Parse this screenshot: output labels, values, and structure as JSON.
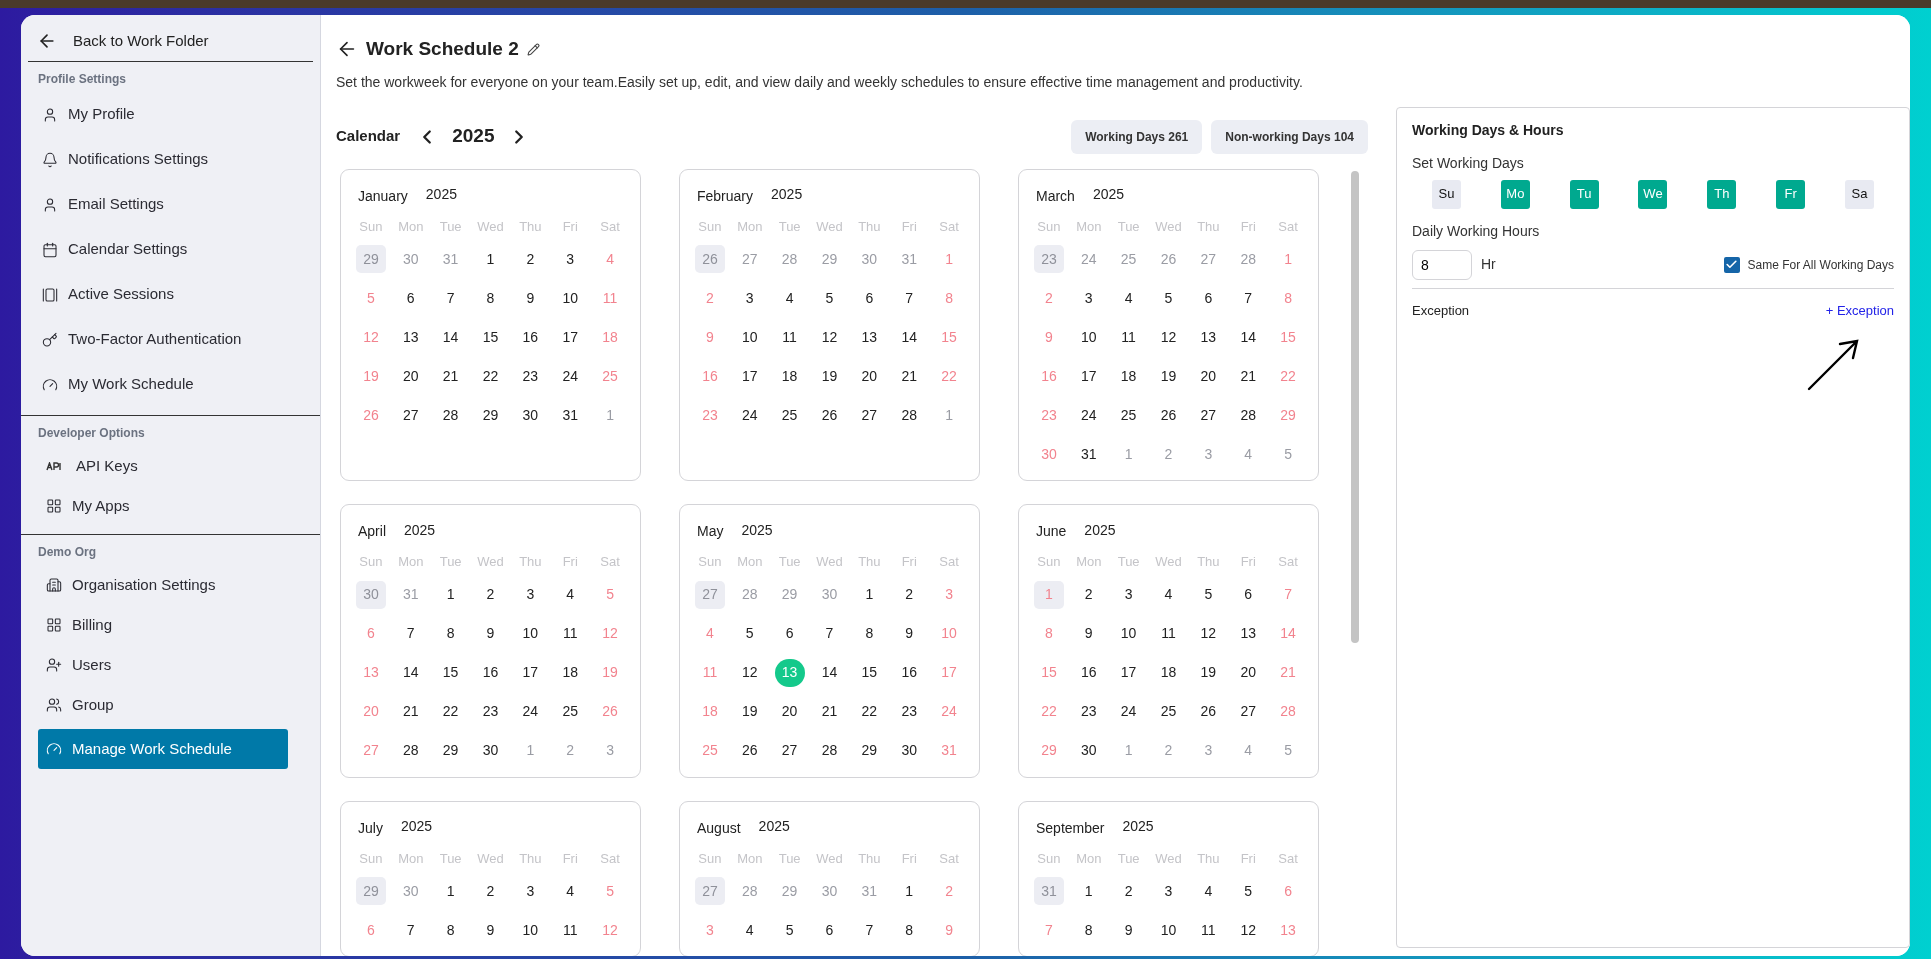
{
  "sidebar": {
    "back": {
      "label": "Back to Work Folder"
    },
    "sections": [
      {
        "title": "Profile Settings",
        "items": [
          {
            "label": "My Profile",
            "selected": false
          },
          {
            "label": "Notifications Settings",
            "selected": false
          },
          {
            "label": "Email Settings",
            "selected": false
          },
          {
            "label": "Calendar Settings",
            "selected": false
          },
          {
            "label": "Active Sessions",
            "selected": false
          },
          {
            "label": "Two-Factor Authentication",
            "selected": false
          },
          {
            "label": "My Work Schedule",
            "selected": false
          }
        ]
      },
      {
        "title": "Developer Options",
        "items": [
          {
            "label": "API Keys",
            "selected": false
          },
          {
            "label": "My Apps",
            "selected": false
          }
        ]
      },
      {
        "title": "Demo Org",
        "items": [
          {
            "label": "Organisation Settings",
            "selected": false
          },
          {
            "label": "Billing",
            "selected": false
          },
          {
            "label": "Users",
            "selected": false
          },
          {
            "label": "Group",
            "selected": false
          },
          {
            "label": "Manage Work Schedule",
            "selected": true
          }
        ]
      }
    ]
  },
  "header": {
    "title": "Work Schedule 2",
    "description": "Set the workweek for everyone on your team.Easily set up, edit, and view daily and weekly schedules to ensure effective time management and productivity."
  },
  "calendar": {
    "label": "Calendar",
    "year": "2025",
    "stats": [
      "Working Days 261",
      "Non-working Days 104"
    ],
    "months": [
      {
        "name": "January",
        "year": "2025",
        "weekdays": [
          "Sun",
          "Mon",
          "Tue",
          "Wed",
          "Thu",
          "Fri",
          "Sat"
        ],
        "weeks": [
          [
            {
              "day": "29",
              "kind": "out_mark"
            },
            {
              "day": "30",
              "kind": "out"
            },
            {
              "day": "31",
              "kind": "out"
            },
            {
              "day": "1",
              "kind": "work"
            },
            {
              "day": "2",
              "kind": "work"
            },
            {
              "day": "3",
              "kind": "work"
            },
            {
              "day": "4",
              "kind": "off"
            }
          ],
          [
            {
              "day": "5",
              "kind": "off"
            },
            {
              "day": "6",
              "kind": "work"
            },
            {
              "day": "7",
              "kind": "work"
            },
            {
              "day": "8",
              "kind": "work"
            },
            {
              "day": "9",
              "kind": "work"
            },
            {
              "day": "10",
              "kind": "work"
            },
            {
              "day": "11",
              "kind": "off"
            }
          ],
          [
            {
              "day": "12",
              "kind": "off"
            },
            {
              "day": "13",
              "kind": "work"
            },
            {
              "day": "14",
              "kind": "work"
            },
            {
              "day": "15",
              "kind": "work"
            },
            {
              "day": "16",
              "kind": "work"
            },
            {
              "day": "17",
              "kind": "work"
            },
            {
              "day": "18",
              "kind": "off"
            }
          ],
          [
            {
              "day": "19",
              "kind": "off"
            },
            {
              "day": "20",
              "kind": "work"
            },
            {
              "day": "21",
              "kind": "work"
            },
            {
              "day": "22",
              "kind": "work"
            },
            {
              "day": "23",
              "kind": "work"
            },
            {
              "day": "24",
              "kind": "work"
            },
            {
              "day": "25",
              "kind": "off"
            }
          ],
          [
            {
              "day": "26",
              "kind": "off"
            },
            {
              "day": "27",
              "kind": "work"
            },
            {
              "day": "28",
              "kind": "work"
            },
            {
              "day": "29",
              "kind": "work"
            },
            {
              "day": "30",
              "kind": "work"
            },
            {
              "day": "31",
              "kind": "work"
            },
            {
              "day": "1",
              "kind": "out"
            }
          ]
        ]
      },
      {
        "name": "February",
        "year": "2025",
        "weekdays": [
          "Sun",
          "Mon",
          "Tue",
          "Wed",
          "Thu",
          "Fri",
          "Sat"
        ],
        "weeks": [
          [
            {
              "day": "26",
              "kind": "out_mark"
            },
            {
              "day": "27",
              "kind": "out"
            },
            {
              "day": "28",
              "kind": "out"
            },
            {
              "day": "29",
              "kind": "out"
            },
            {
              "day": "30",
              "kind": "out"
            },
            {
              "day": "31",
              "kind": "out"
            },
            {
              "day": "1",
              "kind": "off"
            }
          ],
          [
            {
              "day": "2",
              "kind": "off"
            },
            {
              "day": "3",
              "kind": "work"
            },
            {
              "day": "4",
              "kind": "work"
            },
            {
              "day": "5",
              "kind": "work"
            },
            {
              "day": "6",
              "kind": "work"
            },
            {
              "day": "7",
              "kind": "work"
            },
            {
              "day": "8",
              "kind": "off"
            }
          ],
          [
            {
              "day": "9",
              "kind": "off"
            },
            {
              "day": "10",
              "kind": "work"
            },
            {
              "day": "11",
              "kind": "work"
            },
            {
              "day": "12",
              "kind": "work"
            },
            {
              "day": "13",
              "kind": "work"
            },
            {
              "day": "14",
              "kind": "work"
            },
            {
              "day": "15",
              "kind": "off"
            }
          ],
          [
            {
              "day": "16",
              "kind": "off"
            },
            {
              "day": "17",
              "kind": "work"
            },
            {
              "day": "18",
              "kind": "work"
            },
            {
              "day": "19",
              "kind": "work"
            },
            {
              "day": "20",
              "kind": "work"
            },
            {
              "day": "21",
              "kind": "work"
            },
            {
              "day": "22",
              "kind": "off"
            }
          ],
          [
            {
              "day": "23",
              "kind": "off"
            },
            {
              "day": "24",
              "kind": "work"
            },
            {
              "day": "25",
              "kind": "work"
            },
            {
              "day": "26",
              "kind": "work"
            },
            {
              "day": "27",
              "kind": "work"
            },
            {
              "day": "28",
              "kind": "work"
            },
            {
              "day": "1",
              "kind": "out"
            }
          ]
        ]
      },
      {
        "name": "March",
        "year": "2025",
        "weekdays": [
          "Sun",
          "Mon",
          "Tue",
          "Wed",
          "Thu",
          "Fri",
          "Sat"
        ],
        "weeks": [
          [
            {
              "day": "23",
              "kind": "out_mark"
            },
            {
              "day": "24",
              "kind": "out"
            },
            {
              "day": "25",
              "kind": "out"
            },
            {
              "day": "26",
              "kind": "out"
            },
            {
              "day": "27",
              "kind": "out"
            },
            {
              "day": "28",
              "kind": "out"
            },
            {
              "day": "1",
              "kind": "off"
            }
          ],
          [
            {
              "day": "2",
              "kind": "off"
            },
            {
              "day": "3",
              "kind": "work"
            },
            {
              "day": "4",
              "kind": "work"
            },
            {
              "day": "5",
              "kind": "work"
            },
            {
              "day": "6",
              "kind": "work"
            },
            {
              "day": "7",
              "kind": "work"
            },
            {
              "day": "8",
              "kind": "off"
            }
          ],
          [
            {
              "day": "9",
              "kind": "off"
            },
            {
              "day": "10",
              "kind": "work"
            },
            {
              "day": "11",
              "kind": "work"
            },
            {
              "day": "12",
              "kind": "work"
            },
            {
              "day": "13",
              "kind": "work"
            },
            {
              "day": "14",
              "kind": "work"
            },
            {
              "day": "15",
              "kind": "off"
            }
          ],
          [
            {
              "day": "16",
              "kind": "off"
            },
            {
              "day": "17",
              "kind": "work"
            },
            {
              "day": "18",
              "kind": "work"
            },
            {
              "day": "19",
              "kind": "work"
            },
            {
              "day": "20",
              "kind": "work"
            },
            {
              "day": "21",
              "kind": "work"
            },
            {
              "day": "22",
              "kind": "off"
            }
          ],
          [
            {
              "day": "23",
              "kind": "off"
            },
            {
              "day": "24",
              "kind": "work"
            },
            {
              "day": "25",
              "kind": "work"
            },
            {
              "day": "26",
              "kind": "work"
            },
            {
              "day": "27",
              "kind": "work"
            },
            {
              "day": "28",
              "kind": "work"
            },
            {
              "day": "29",
              "kind": "off"
            }
          ],
          [
            {
              "day": "30",
              "kind": "off"
            },
            {
              "day": "31",
              "kind": "work"
            },
            {
              "day": "1",
              "kind": "out"
            },
            {
              "day": "2",
              "kind": "out"
            },
            {
              "day": "3",
              "kind": "out"
            },
            {
              "day": "4",
              "kind": "out"
            },
            {
              "day": "5",
              "kind": "out"
            }
          ]
        ]
      },
      {
        "name": "April",
        "year": "2025",
        "weekdays": [
          "Sun",
          "Mon",
          "Tue",
          "Wed",
          "Thu",
          "Fri",
          "Sat"
        ],
        "weeks": [
          [
            {
              "day": "30",
              "kind": "out_mark"
            },
            {
              "day": "31",
              "kind": "out"
            },
            {
              "day": "1",
              "kind": "work"
            },
            {
              "day": "2",
              "kind": "work"
            },
            {
              "day": "3",
              "kind": "work"
            },
            {
              "day": "4",
              "kind": "work"
            },
            {
              "day": "5",
              "kind": "off"
            }
          ],
          [
            {
              "day": "6",
              "kind": "off"
            },
            {
              "day": "7",
              "kind": "work"
            },
            {
              "day": "8",
              "kind": "work"
            },
            {
              "day": "9",
              "kind": "work"
            },
            {
              "day": "10",
              "kind": "work"
            },
            {
              "day": "11",
              "kind": "work"
            },
            {
              "day": "12",
              "kind": "off"
            }
          ],
          [
            {
              "day": "13",
              "kind": "off"
            },
            {
              "day": "14",
              "kind": "work"
            },
            {
              "day": "15",
              "kind": "work"
            },
            {
              "day": "16",
              "kind": "work"
            },
            {
              "day": "17",
              "kind": "work"
            },
            {
              "day": "18",
              "kind": "work"
            },
            {
              "day": "19",
              "kind": "off"
            }
          ],
          [
            {
              "day": "20",
              "kind": "off"
            },
            {
              "day": "21",
              "kind": "work"
            },
            {
              "day": "22",
              "kind": "work"
            },
            {
              "day": "23",
              "kind": "work"
            },
            {
              "day": "24",
              "kind": "work"
            },
            {
              "day": "25",
              "kind": "work"
            },
            {
              "day": "26",
              "kind": "off"
            }
          ],
          [
            {
              "day": "27",
              "kind": "off"
            },
            {
              "day": "28",
              "kind": "work"
            },
            {
              "day": "29",
              "kind": "work"
            },
            {
              "day": "30",
              "kind": "work"
            },
            {
              "day": "1",
              "kind": "out"
            },
            {
              "day": "2",
              "kind": "out"
            },
            {
              "day": "3",
              "kind": "out"
            }
          ]
        ]
      },
      {
        "name": "May",
        "year": "2025",
        "weekdays": [
          "Sun",
          "Mon",
          "Tue",
          "Wed",
          "Thu",
          "Fri",
          "Sat"
        ],
        "weeks": [
          [
            {
              "day": "27",
              "kind": "out_mark"
            },
            {
              "day": "28",
              "kind": "out"
            },
            {
              "day": "29",
              "kind": "out"
            },
            {
              "day": "30",
              "kind": "out"
            },
            {
              "day": "1",
              "kind": "work"
            },
            {
              "day": "2",
              "kind": "work"
            },
            {
              "day": "3",
              "kind": "off"
            }
          ],
          [
            {
              "day": "4",
              "kind": "off"
            },
            {
              "day": "5",
              "kind": "work"
            },
            {
              "day": "6",
              "kind": "work"
            },
            {
              "day": "7",
              "kind": "work"
            },
            {
              "day": "8",
              "kind": "work"
            },
            {
              "day": "9",
              "kind": "work"
            },
            {
              "day": "10",
              "kind": "off"
            }
          ],
          [
            {
              "day": "11",
              "kind": "off"
            },
            {
              "day": "12",
              "kind": "work"
            },
            {
              "day": "13",
              "kind": "today"
            },
            {
              "day": "14",
              "kind": "work"
            },
            {
              "day": "15",
              "kind": "work"
            },
            {
              "day": "16",
              "kind": "work"
            },
            {
              "day": "17",
              "kind": "off"
            }
          ],
          [
            {
              "day": "18",
              "kind": "off"
            },
            {
              "day": "19",
              "kind": "work"
            },
            {
              "day": "20",
              "kind": "work"
            },
            {
              "day": "21",
              "kind": "work"
            },
            {
              "day": "22",
              "kind": "work"
            },
            {
              "day": "23",
              "kind": "work"
            },
            {
              "day": "24",
              "kind": "off"
            }
          ],
          [
            {
              "day": "25",
              "kind": "off"
            },
            {
              "day": "26",
              "kind": "work"
            },
            {
              "day": "27",
              "kind": "work"
            },
            {
              "day": "28",
              "kind": "work"
            },
            {
              "day": "29",
              "kind": "work"
            },
            {
              "day": "30",
              "kind": "work"
            },
            {
              "day": "31",
              "kind": "off"
            }
          ]
        ]
      },
      {
        "name": "June",
        "year": "2025",
        "weekdays": [
          "Sun",
          "Mon",
          "Tue",
          "Wed",
          "Thu",
          "Fri",
          "Sat"
        ],
        "weeks": [
          [
            {
              "day": "1",
              "kind": "off_mark"
            },
            {
              "day": "2",
              "kind": "work"
            },
            {
              "day": "3",
              "kind": "work"
            },
            {
              "day": "4",
              "kind": "work"
            },
            {
              "day": "5",
              "kind": "work"
            },
            {
              "day": "6",
              "kind": "work"
            },
            {
              "day": "7",
              "kind": "off"
            }
          ],
          [
            {
              "day": "8",
              "kind": "off"
            },
            {
              "day": "9",
              "kind": "work"
            },
            {
              "day": "10",
              "kind": "work"
            },
            {
              "day": "11",
              "kind": "work"
            },
            {
              "day": "12",
              "kind": "work"
            },
            {
              "day": "13",
              "kind": "work"
            },
            {
              "day": "14",
              "kind": "off"
            }
          ],
          [
            {
              "day": "15",
              "kind": "off"
            },
            {
              "day": "16",
              "kind": "work"
            },
            {
              "day": "17",
              "kind": "work"
            },
            {
              "day": "18",
              "kind": "work"
            },
            {
              "day": "19",
              "kind": "work"
            },
            {
              "day": "20",
              "kind": "work"
            },
            {
              "day": "21",
              "kind": "off"
            }
          ],
          [
            {
              "day": "22",
              "kind": "off"
            },
            {
              "day": "23",
              "kind": "work"
            },
            {
              "day": "24",
              "kind": "work"
            },
            {
              "day": "25",
              "kind": "work"
            },
            {
              "day": "26",
              "kind": "work"
            },
            {
              "day": "27",
              "kind": "work"
            },
            {
              "day": "28",
              "kind": "off"
            }
          ],
          [
            {
              "day": "29",
              "kind": "off"
            },
            {
              "day": "30",
              "kind": "work"
            },
            {
              "day": "1",
              "kind": "out"
            },
            {
              "day": "2",
              "kind": "out"
            },
            {
              "day": "3",
              "kind": "out"
            },
            {
              "day": "4",
              "kind": "out"
            },
            {
              "day": "5",
              "kind": "out"
            }
          ]
        ]
      },
      {
        "name": "July",
        "year": "2025",
        "weekdays": [
          "Sun",
          "Mon",
          "Tue",
          "Wed",
          "Thu",
          "Fri",
          "Sat"
        ],
        "weeks": [
          [
            {
              "day": "29",
              "kind": "out_mark"
            },
            {
              "day": "30",
              "kind": "out"
            },
            {
              "day": "1",
              "kind": "work"
            },
            {
              "day": "2",
              "kind": "work"
            },
            {
              "day": "3",
              "kind": "work"
            },
            {
              "day": "4",
              "kind": "work"
            },
            {
              "day": "5",
              "kind": "off"
            }
          ],
          [
            {
              "day": "6",
              "kind": "off"
            },
            {
              "day": "7",
              "kind": "work"
            },
            {
              "day": "8",
              "kind": "work"
            },
            {
              "day": "9",
              "kind": "work"
            },
            {
              "day": "10",
              "kind": "work"
            },
            {
              "day": "11",
              "kind": "work"
            },
            {
              "day": "12",
              "kind": "off"
            }
          ]
        ]
      },
      {
        "name": "August",
        "year": "2025",
        "weekdays": [
          "Sun",
          "Mon",
          "Tue",
          "Wed",
          "Thu",
          "Fri",
          "Sat"
        ],
        "weeks": [
          [
            {
              "day": "27",
              "kind": "out_mark"
            },
            {
              "day": "28",
              "kind": "out"
            },
            {
              "day": "29",
              "kind": "out"
            },
            {
              "day": "30",
              "kind": "out"
            },
            {
              "day": "31",
              "kind": "out"
            },
            {
              "day": "1",
              "kind": "work"
            },
            {
              "day": "2",
              "kind": "off"
            }
          ],
          [
            {
              "day": "3",
              "kind": "off"
            },
            {
              "day": "4",
              "kind": "work"
            },
            {
              "day": "5",
              "kind": "work"
            },
            {
              "day": "6",
              "kind": "work"
            },
            {
              "day": "7",
              "kind": "work"
            },
            {
              "day": "8",
              "kind": "work"
            },
            {
              "day": "9",
              "kind": "off"
            }
          ]
        ]
      },
      {
        "name": "September",
        "year": "2025",
        "weekdays": [
          "Sun",
          "Mon",
          "Tue",
          "Wed",
          "Thu",
          "Fri",
          "Sat"
        ],
        "weeks": [
          [
            {
              "day": "31",
              "kind": "out_mark"
            },
            {
              "day": "1",
              "kind": "work"
            },
            {
              "day": "2",
              "kind": "work"
            },
            {
              "day": "3",
              "kind": "work"
            },
            {
              "day": "4",
              "kind": "work"
            },
            {
              "day": "5",
              "kind": "work"
            },
            {
              "day": "6",
              "kind": "off"
            }
          ],
          [
            {
              "day": "7",
              "kind": "off"
            },
            {
              "day": "8",
              "kind": "work"
            },
            {
              "day": "9",
              "kind": "work"
            },
            {
              "day": "10",
              "kind": "work"
            },
            {
              "day": "11",
              "kind": "work"
            },
            {
              "day": "12",
              "kind": "work"
            },
            {
              "day": "13",
              "kind": "off"
            }
          ]
        ]
      }
    ]
  },
  "settings": {
    "title": "Working Days & Hours",
    "days_label": "Set Working Days",
    "days": [
      {
        "label": "Su",
        "selected": false
      },
      {
        "label": "Mo",
        "selected": true
      },
      {
        "label": "Tu",
        "selected": true
      },
      {
        "label": "We",
        "selected": true
      },
      {
        "label": "Th",
        "selected": true
      },
      {
        "label": "Fr",
        "selected": true
      },
      {
        "label": "Sa",
        "selected": false
      }
    ],
    "hours_label": "Daily Working Hours",
    "hours": "8",
    "unit": "Hr",
    "same_for_all": {
      "label": "Same For All Working Days",
      "checked": true
    },
    "exception_label": "Exception",
    "add_exception": "+ Exception"
  }
}
